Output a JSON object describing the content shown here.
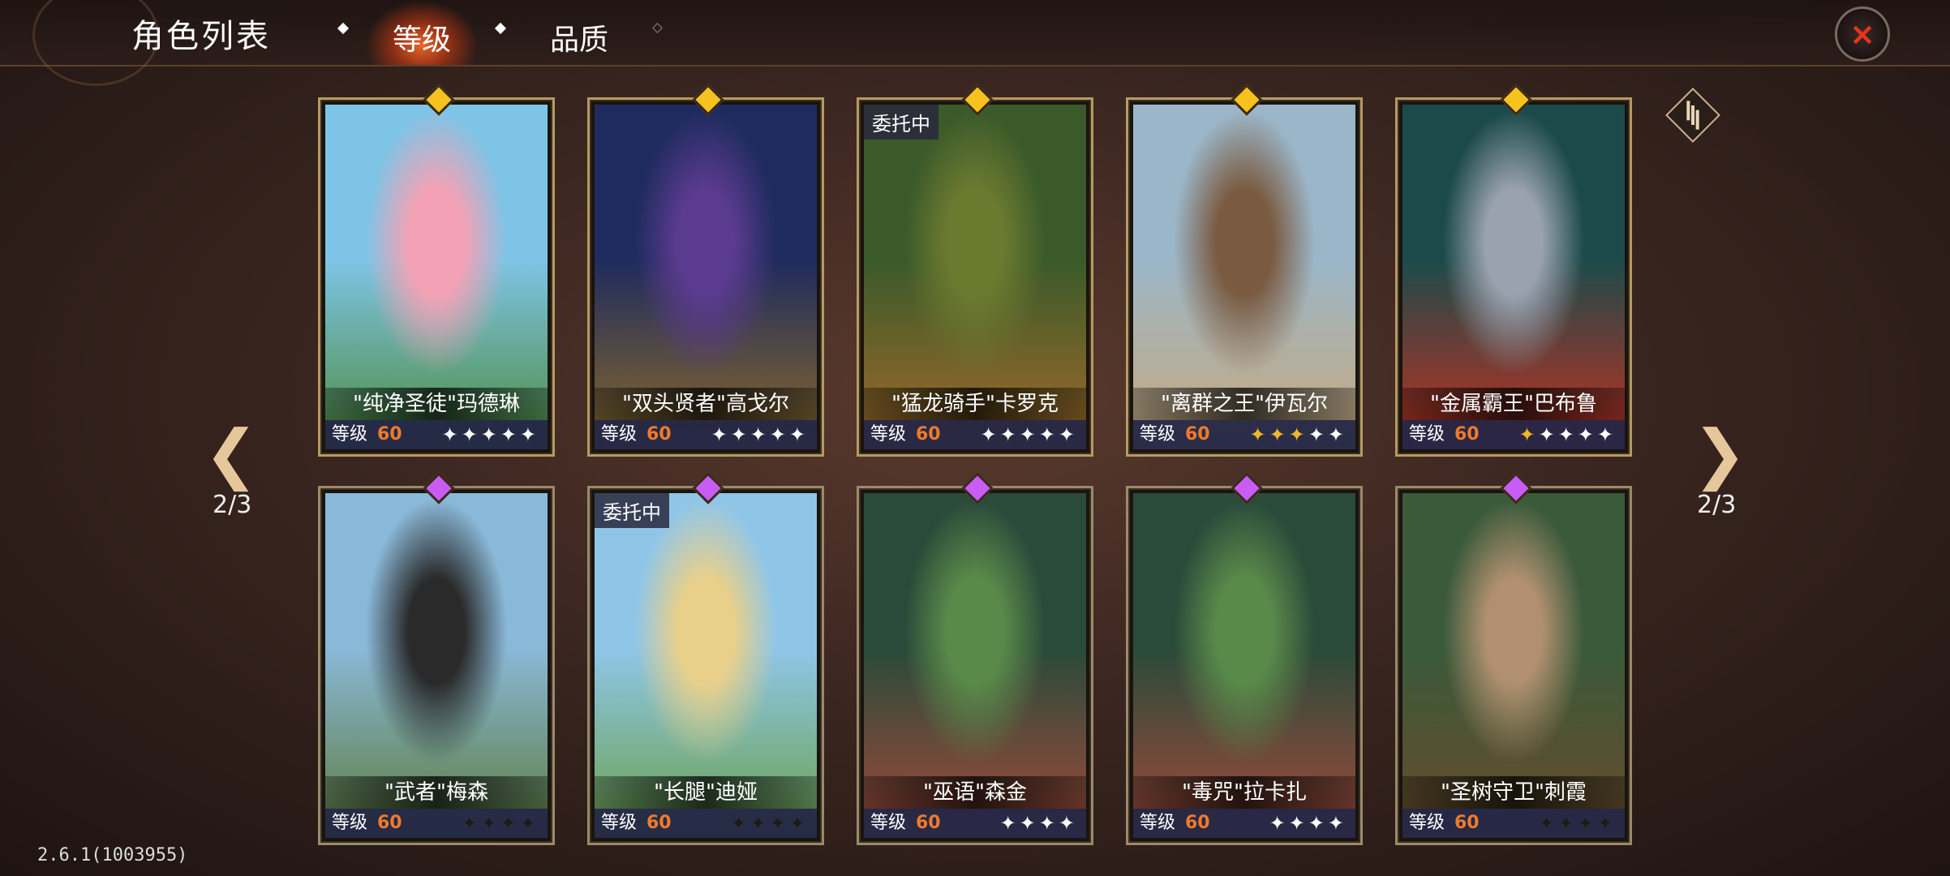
{
  "header": {
    "title": "角色列表",
    "tabs": [
      {
        "label": "等级",
        "active": true
      },
      {
        "label": "品质",
        "active": false
      }
    ],
    "close_icon": "×"
  },
  "pager": {
    "left": "2/3",
    "right": "2/3"
  },
  "version": "2.6.1(1003955)",
  "level_label": "等级",
  "cards": [
    {
      "name": "\"纯净圣徒\"玛德琳",
      "level": "60",
      "stars": "✦✦✦✦✦",
      "star_style": "on",
      "gem": "gold",
      "busy": "",
      "colors": [
        "#7ec4e6",
        "#f3a2b5",
        "#4c8a3a"
      ]
    },
    {
      "name": "\"双头贤者\"高戈尔",
      "level": "60",
      "stars": "✦✦✦✦✦",
      "star_style": "on",
      "gem": "gold",
      "busy": "",
      "colors": [
        "#1f2b5e",
        "#5b3b8f",
        "#8a6a2a"
      ]
    },
    {
      "name": "\"猛龙骑手\"卡罗克",
      "level": "60",
      "stars": "✦✦✦✦✦",
      "star_style": "on",
      "gem": "gold",
      "busy": "委托中",
      "colors": [
        "#3a5a2a",
        "#6c7a30",
        "#a36a2a"
      ]
    },
    {
      "name": "\"离群之王\"伊瓦尔",
      "level": "60",
      "stars": "✦✦✦✦✦",
      "star_style": "mixed3",
      "gem": "gold",
      "busy": "",
      "colors": [
        "#9bb6c8",
        "#7a5a40",
        "#c9a87a"
      ]
    },
    {
      "name": "\"金属霸王\"巴布鲁",
      "level": "60",
      "stars": "✦✦✦✦✦",
      "star_style": "mixed1",
      "gem": "gold",
      "busy": "",
      "colors": [
        "#1c4a4a",
        "#9aa2b0",
        "#c43020"
      ]
    },
    {
      "name": "\"武者\"梅森",
      "level": "60",
      "stars": "✦✦✦✦",
      "star_style": "off",
      "gem": "purple",
      "busy": "",
      "colors": [
        "#8ab8d8",
        "#2a2a2a",
        "#5a7a3a"
      ]
    },
    {
      "name": "\"长腿\"迪娅",
      "level": "60",
      "stars": "✦✦✦✦",
      "star_style": "off",
      "gem": "purple",
      "busy": "委托中",
      "colors": [
        "#8fc6e8",
        "#e8d08a",
        "#6aa04a"
      ]
    },
    {
      "name": "\"巫语\"森金",
      "level": "60",
      "stars": "✦✦✦✦",
      "star_style": "on",
      "gem": "purple",
      "busy": "",
      "colors": [
        "#2a4a3a",
        "#5a8a4a",
        "#a34a3a"
      ]
    },
    {
      "name": "\"毒咒\"拉卡扎",
      "level": "60",
      "stars": "✦✦✦✦",
      "star_style": "on",
      "gem": "purple",
      "busy": "",
      "colors": [
        "#2a4a3a",
        "#5a8a4a",
        "#a34a3a"
      ]
    },
    {
      "name": "\"圣树守卫\"刺霞",
      "level": "60",
      "stars": "✦✦✦✦",
      "star_style": "off",
      "gem": "purple",
      "busy": "",
      "colors": [
        "#3a5a3a",
        "#b09070",
        "#6a4a2a"
      ]
    }
  ]
}
